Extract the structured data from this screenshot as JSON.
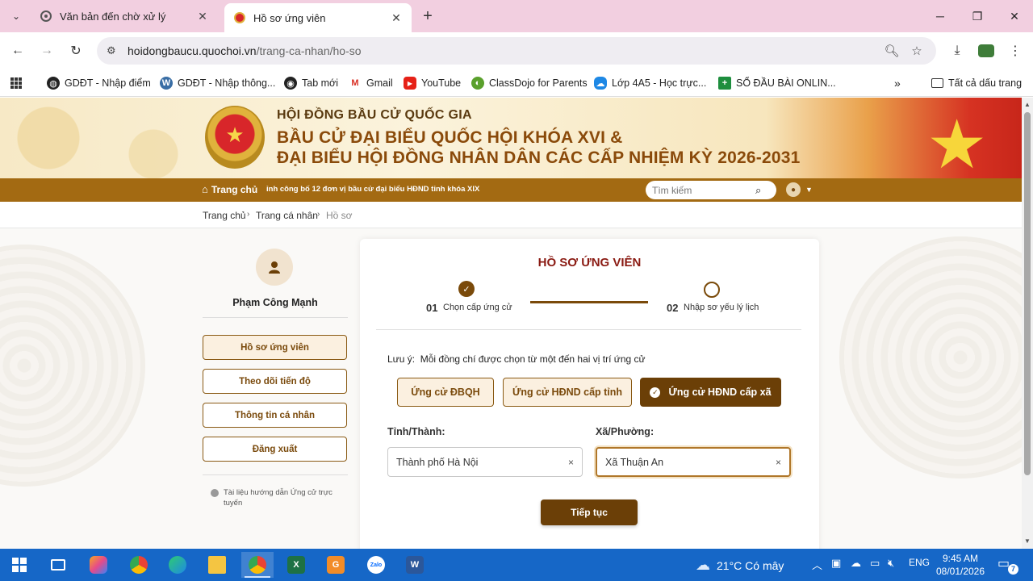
{
  "browser": {
    "tabs": [
      {
        "title": "Văn bản đến chờ xử lý",
        "active": false
      },
      {
        "title": "Hồ sơ ứng viên",
        "active": true
      }
    ],
    "url_domain": "hoidongbaucu.quochoi.vn",
    "url_path": "/trang-ca-nhan/ho-so",
    "bookmarks": [
      {
        "label": "GDĐT - Nhập điểm",
        "icon": "globe-icon"
      },
      {
        "label": "GDĐT - Nhập thông...",
        "icon": "wordpress-icon"
      },
      {
        "label": "Tab mới",
        "icon": "chrome-icon"
      },
      {
        "label": "Gmail",
        "icon": "gmail-icon"
      },
      {
        "label": "YouTube",
        "icon": "youtube-icon"
      },
      {
        "label": "ClassDojo for Parents",
        "icon": "classdojo-icon"
      },
      {
        "label": "Lớp 4A5 - Học trực...",
        "icon": "onedrive-icon"
      },
      {
        "label": "SỔ ĐẦU BÀI ONLIN...",
        "icon": "sheets-icon"
      }
    ],
    "all_bookmarks": "Tất cả dấu trang"
  },
  "banner": {
    "org": "HỘI ĐỒNG BẦU CỬ QUỐC GIA",
    "line1": "BẦU CỬ ĐẠI BIỂU QUỐC HỘI KHÓA XVI &",
    "line2": "ĐẠI BIỂU HỘI ĐỒNG NHÂN DÂN CÁC CẤP NHIỆM KỲ 2026-2031"
  },
  "nav": {
    "home": "Trang chủ",
    "ticker": "ỉnh công bố 12 đơn vị bầu cử đại biểu HĐND tỉnh khóa XIX",
    "search_placeholder": "Tìm kiếm"
  },
  "breadcrumb": [
    "Trang chủ",
    "Trang cá nhân",
    "Hồ sơ"
  ],
  "sidebar": {
    "name": "Phạm Công Mạnh",
    "menu": [
      "Hồ sơ ứng viên",
      "Theo dõi tiến độ",
      "Thông tin cá nhân",
      "Đăng xuất"
    ],
    "doc_link": "Tài liệu hướng dẫn Ứng cử trực tuyến"
  },
  "form": {
    "title": "HỒ SƠ ỨNG VIÊN",
    "steps": [
      {
        "num": "01",
        "label": "Chọn cấp ứng cử",
        "done": true
      },
      {
        "num": "02",
        "label": "Nhập sơ yếu lý lịch",
        "done": false
      }
    ],
    "note_label": "Lưu ý:",
    "note_text": "Mỗi đồng chí được chọn từ một đến hai vị trí ứng cử",
    "options": [
      {
        "label": "Ứng cử ĐBQH",
        "selected": false
      },
      {
        "label": "Ứng cử HĐND cấp tỉnh",
        "selected": false
      },
      {
        "label": "Ứng cử HĐND cấp xã",
        "selected": true
      }
    ],
    "province_label": "Tỉnh/Thành:",
    "province_value": "Thành phố Hà Nội",
    "ward_label": "Xã/Phường:",
    "ward_value": "Xã Thuận An",
    "continue": "Tiếp tục",
    "clear_symbol": "×"
  },
  "taskbar": {
    "weather": "21°C  Có mây",
    "lang": "ENG",
    "time": "9:45 AM",
    "date": "08/01/2026",
    "notifications": "7"
  },
  "colors": {
    "brand_brown": "#6b3f07",
    "nav_bar": "#a36a12",
    "title_red": "#8a1a12",
    "taskbar": "#1667c7"
  }
}
